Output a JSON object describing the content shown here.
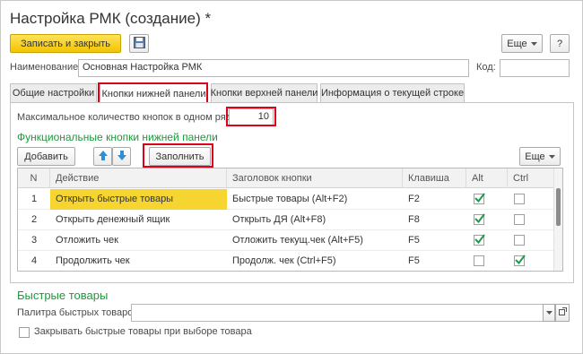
{
  "window": {
    "title": "Настройка РМК (создание) *"
  },
  "toolbar": {
    "save_close": "Записать и закрыть",
    "more": "Еще",
    "help": "?"
  },
  "form": {
    "name_label": "Наименование:",
    "name_value": "Основная Настройка РМК",
    "code_label": "Код:",
    "code_value": ""
  },
  "tabs": [
    {
      "label": "Общие настройки"
    },
    {
      "label": "Кнопки нижней панели"
    },
    {
      "label": "Кнопки верхней панели"
    },
    {
      "label": "Информация о текущей строке"
    }
  ],
  "bottom_panel": {
    "max_buttons_label": "Максимальное количество кнопок в одном ряду:",
    "max_buttons_value": "10",
    "section_title": "Функциональные кнопки нижней панели",
    "add_button": "Добавить",
    "fill_button": "Заполнить",
    "more": "Еще"
  },
  "table": {
    "headers": [
      "N",
      "Действие",
      "Заголовок кнопки",
      "Клавиша",
      "Alt",
      "Ctrl"
    ],
    "rows": [
      {
        "n": "1",
        "action": "Открыть быстрые товары",
        "caption": "Быстрые товары (Alt+F2)",
        "key": "F2",
        "alt": true,
        "ctrl": false
      },
      {
        "n": "2",
        "action": "Открыть денежный ящик",
        "caption": "Открыть ДЯ (Alt+F8)",
        "key": "F8",
        "alt": true,
        "ctrl": false
      },
      {
        "n": "3",
        "action": "Отложить чек",
        "caption": "Отложить текущ.чек (Alt+F5)",
        "key": "F5",
        "alt": true,
        "ctrl": false
      },
      {
        "n": "4",
        "action": "Продолжить чек",
        "caption": "Продолж. чек (Ctrl+F5)",
        "key": "F5",
        "alt": false,
        "ctrl": true
      }
    ]
  },
  "quick_goods": {
    "title": "Быстрые товары",
    "palette_label": "Палитра быстрых товаров:",
    "palette_value": "",
    "close_on_select_label": "Закрывать быстрые товары при выборе товара"
  },
  "colors": {
    "accent_yellow": "#f3c400",
    "section_green": "#1b9a3b",
    "highlight_red": "#e1001a"
  }
}
